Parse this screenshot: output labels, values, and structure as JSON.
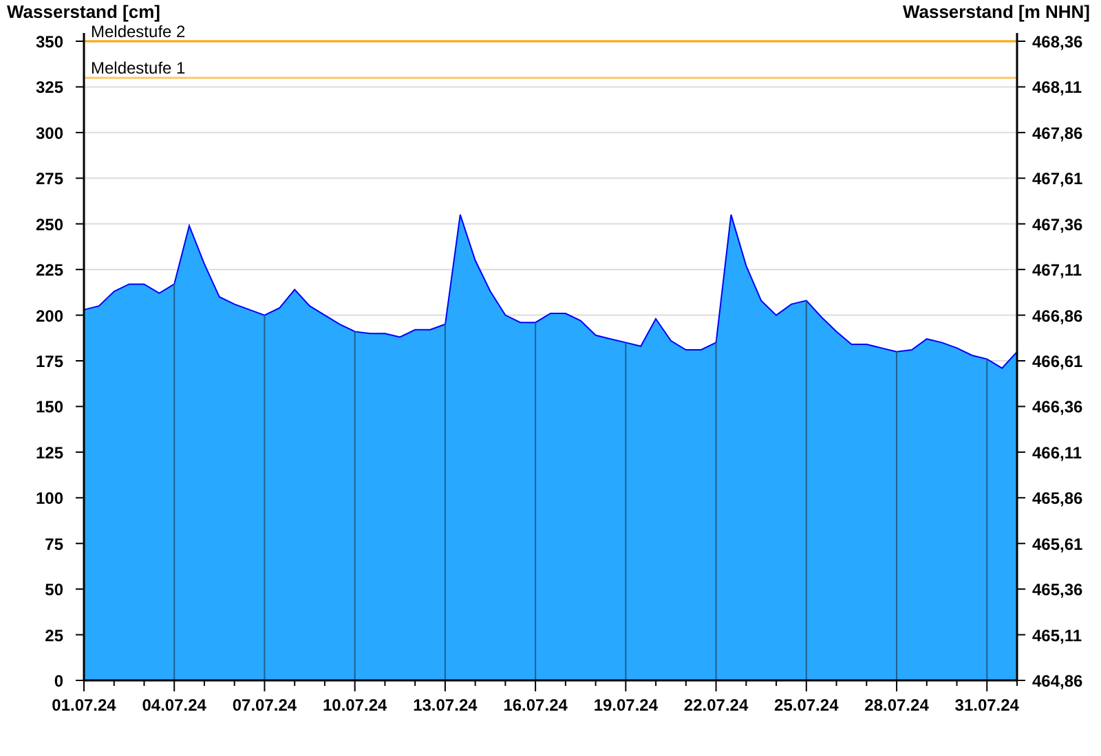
{
  "chart": {
    "chart_data": {
      "type": "area",
      "ylabel": "Wasserstand [cm]",
      "categories": [
        "01.07.24",
        null,
        null,
        null,
        null,
        null,
        "04.07.24",
        null,
        null,
        null,
        null,
        null,
        "07.07.24",
        null,
        null,
        null,
        null,
        null,
        "10.07.24",
        null,
        null,
        null,
        null,
        null,
        "13.07.24",
        null,
        null,
        null,
        null,
        null,
        "16.07.24",
        null,
        null,
        null,
        null,
        null,
        "19.07.24",
        null,
        null,
        null,
        null,
        null,
        "22.07.24",
        null,
        null,
        null,
        null,
        null,
        "25.07.24",
        null,
        null,
        null,
        null,
        null,
        "28.07.24",
        null,
        null,
        null,
        null,
        null,
        "31.07.24",
        null,
        null
      ],
      "series": [
        {
          "color": "#29a8ff",
          "values": [
            203,
            205,
            213,
            217,
            217,
            212,
            217,
            249,
            228,
            210,
            206,
            203,
            200,
            204,
            214,
            205,
            200,
            195,
            191,
            190,
            190,
            188,
            192,
            192,
            195,
            255,
            230,
            213,
            200,
            196,
            196,
            201,
            201,
            197,
            189,
            187,
            185,
            183,
            198,
            186,
            181,
            181,
            185,
            255,
            227,
            208,
            200,
            206,
            208,
            199,
            191,
            184,
            184,
            182,
            180,
            181,
            187,
            185,
            182,
            178,
            176,
            171,
            180
          ]
        }
      ],
      "ylim": [
        0,
        350
      ],
      "grid": true,
      "yticks": [
        0,
        25,
        50,
        75,
        100,
        125,
        150,
        175,
        200,
        225,
        250,
        275,
        300,
        325,
        350
      ],
      "ref_lines": [
        {
          "axis": "y",
          "value": 350,
          "label": "Meldestufe 2",
          "color": "#ffa500"
        },
        {
          "axis": "y",
          "value": 330,
          "label": "Meldestufe 1",
          "color": "#ffc864"
        }
      ]
    },
    "right_axis": {
      "title": "Wasserstand [m NHN]",
      "ticks": [
        "468,36",
        "468,11",
        "467,86",
        "467,61",
        "467,36",
        "467,11",
        "466,86",
        "466,61",
        "466,36",
        "466,11",
        "465,86",
        "465,61",
        "465,36",
        "465,11",
        "464,86"
      ]
    }
  }
}
